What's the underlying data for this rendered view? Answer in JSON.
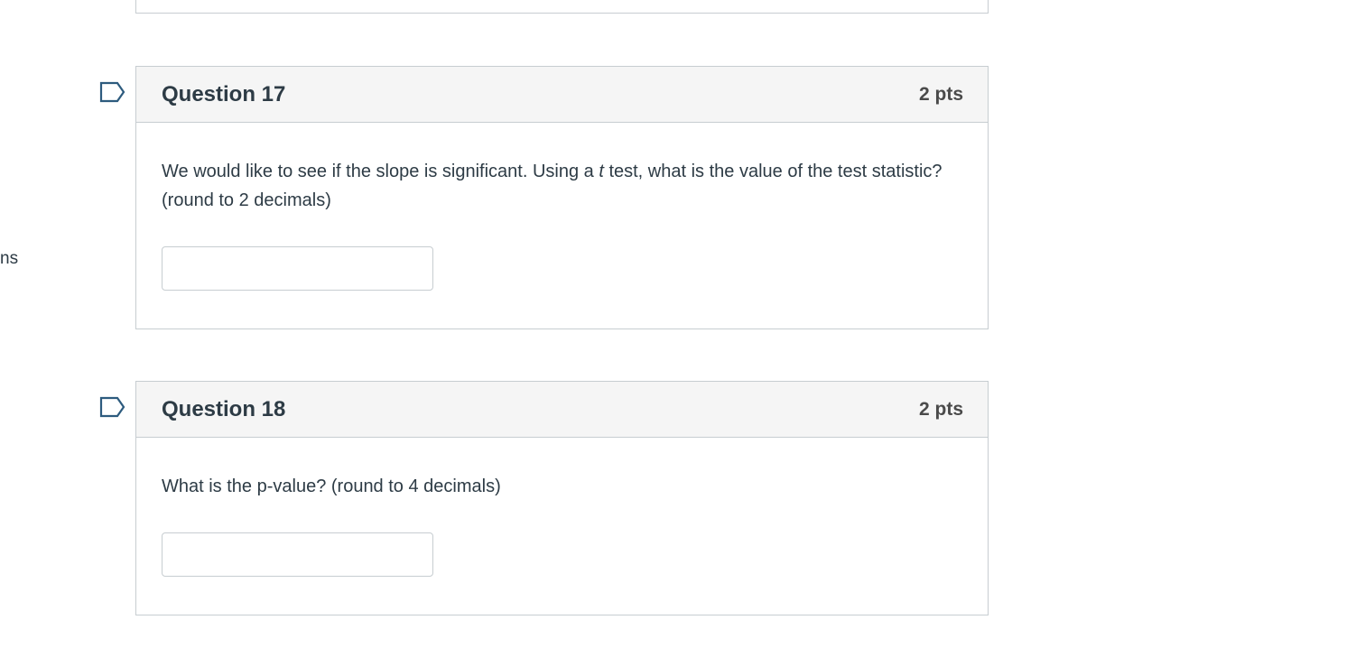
{
  "sidebar_fragment": "ns",
  "questions": [
    {
      "title": "Question 17",
      "points": "2 pts",
      "text_before": "We would like to see if the slope is significant. Using a ",
      "text_italic": "t",
      "text_after": " test, what is the value of the test statistic? (round to 2 decimals)",
      "answer_value": ""
    },
    {
      "title": "Question 18",
      "points": "2 pts",
      "text": "What is the p-value? (round to 4 decimals)",
      "answer_value": ""
    }
  ],
  "icons": {
    "flag": "flag-bookmark-icon"
  },
  "colors": {
    "text": "#2d3b45",
    "border": "#c7cdd1",
    "header_bg": "#f5f5f5",
    "flag_stroke": "#2d5b7e"
  }
}
